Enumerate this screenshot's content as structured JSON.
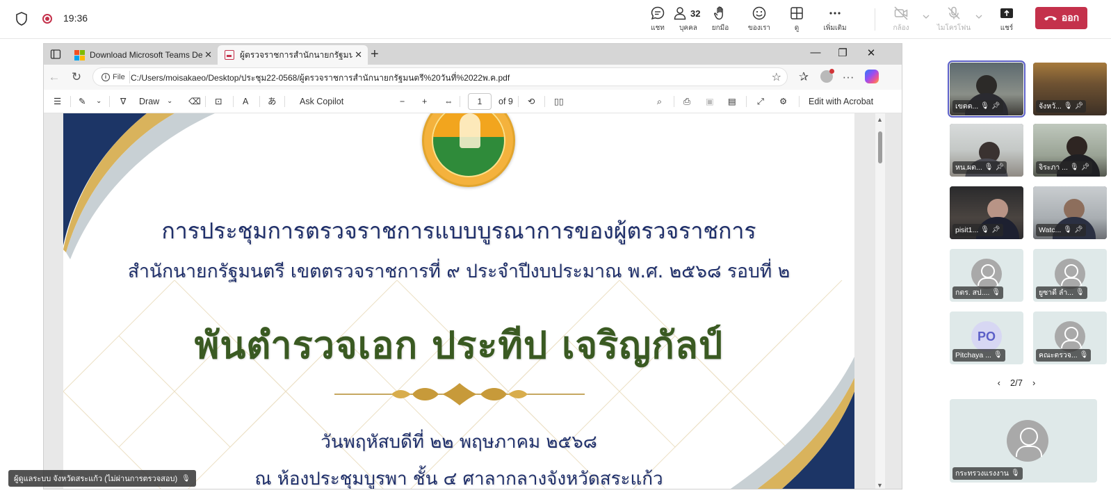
{
  "meeting": {
    "time": "19:36",
    "controls": {
      "chat": "แชท",
      "people": "บุคคล",
      "people_count": "32",
      "raise": "ยกมือ",
      "react": "ของเรา",
      "view": "ดู",
      "more": "เพิ่มเติม",
      "camera": "กล้อง",
      "mic": "ไมโครโฟน",
      "share": "แชร์",
      "leave": "ออก"
    }
  },
  "browser": {
    "tabs": [
      {
        "title": "Download Microsoft Teams Deskt"
      },
      {
        "title": "ผู้ตรวจราชการสำนักนายกรัฐมนตรี วันที่"
      }
    ],
    "file_chip": "File",
    "url": "C:/Users/moisakaeo/Desktop/ประชุม22-0568/ผู้ตรวจราชการสำนักนายกรัฐมนตรี%20วันที่%2022พ.ค.pdf"
  },
  "pdf_toolbar": {
    "draw": "Draw",
    "ask_copilot": "Ask Copilot",
    "page": "1",
    "of_pages": "of 9",
    "edit_acrobat": "Edit with Acrobat"
  },
  "document": {
    "title_line1": "การประชุมการตรวจราชการแบบบูรณาการของผู้ตรวจราชการ",
    "title_line2": "สำนักนายกรัฐมนตรี เขตตรวจราชการที่ ๙ ประจำปีงบประมาณ พ.ศ. ๒๕๖๘ รอบที่ ๒",
    "name": "พันตำรวจเอก ประทีป เจริญกัลป์",
    "date": "วันพฤหัสบดีที่ ๒๒ พฤษภาคม ๒๕๖๘",
    "venue": "ณ ห้องประชุมบูรพา ชั้น ๔ ศาลากลางจังหวัดสระแก้ว"
  },
  "presenter_tag": "ผู้ดูแลระบบ จังหวัดสระแก้ว (ไม่ผ่านการตรวจสอบ)",
  "participants": [
    {
      "name": "เขตต...",
      "type": "video"
    },
    {
      "name": "จังหวั...",
      "type": "video"
    },
    {
      "name": "หน.ผต...",
      "type": "video"
    },
    {
      "name": "จิระภา ...",
      "type": "video"
    },
    {
      "name": "pisit1...",
      "type": "video"
    },
    {
      "name": "Watc...",
      "type": "video"
    },
    {
      "name": "กตร. สป....",
      "type": "avatar"
    },
    {
      "name": "ยูซาดี ลำ...",
      "type": "avatar"
    },
    {
      "name": "Pitchaya ...",
      "type": "initials",
      "initials": "PO"
    },
    {
      "name": "คณะตรวจ...",
      "type": "avatar"
    }
  ],
  "pager": "2/7",
  "bottom_tile": {
    "name": "กระทรวงแรงงาน"
  },
  "colors": {
    "leave": "#c4314b",
    "accent": "#5b5fc7",
    "doc_navy": "#1f2f6a",
    "doc_green": "#3a5a22"
  }
}
